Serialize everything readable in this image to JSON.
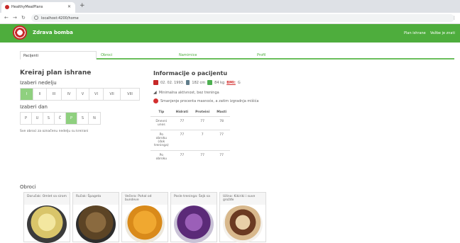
{
  "browser": {
    "tab_title": "HealthyMealPlans",
    "url": "localhost:4200/home"
  },
  "app": {
    "brand": "Zdrava bomba",
    "nav": [
      "Plan ishrane",
      "Vežbe je znati"
    ]
  },
  "tabs": [
    "Pacijenti",
    "Obroci",
    "Namirnice",
    "Profil"
  ],
  "plan": {
    "title": "Kreiraj plan ishrane",
    "week_label": "Izaberi nedelju",
    "weeks": [
      "I",
      "II",
      "III",
      "IV",
      "V",
      "VI",
      "VII",
      "VIII"
    ],
    "selected_week": "I",
    "day_label": "Izaberi dan",
    "days": [
      "P",
      "U",
      "S",
      "Č",
      "P",
      "S",
      "N"
    ],
    "selected_day_index": 4,
    "hint": "Sve obroci za označenu nedelju su kreirani"
  },
  "patient": {
    "title": "Informacije o pacijentu",
    "birth": "02. 02. 1993.",
    "height": "182 cm",
    "weight": "84 kg",
    "bmi_label": "BMI:",
    "bmi_value": "G",
    "activity": "Minimalna aktivnost, bez treninga",
    "goal": "Smanjenje procenta masnoće, a zatim izgradnja mišića",
    "table": {
      "headers": [
        "Tip",
        "Hidrati",
        "Proteini",
        "Masti"
      ],
      "rows": [
        [
          "Dnevni unos",
          "77",
          "77",
          "78"
        ],
        [
          "Po obroku (dok treninga)",
          "77",
          "7",
          "77"
        ],
        [
          "Po obroku",
          "77",
          "77",
          "77"
        ]
      ]
    }
  },
  "meals_section": {
    "title": "Obroci",
    "items": [
      {
        "name": "Doručak: Omlet sa sirom"
      },
      {
        "name": "Ručak: Špageta"
      },
      {
        "name": "Večera: Pohal od bundeve"
      },
      {
        "name": "Posle treninga: Šejk sa"
      },
      {
        "name": "Užina: Kikiriki i suve grožđe"
      }
    ]
  },
  "colors": {
    "brand_green": "#4ead3d",
    "selected_button": "#8fd07f",
    "bmi_red": "#d32f2f"
  }
}
